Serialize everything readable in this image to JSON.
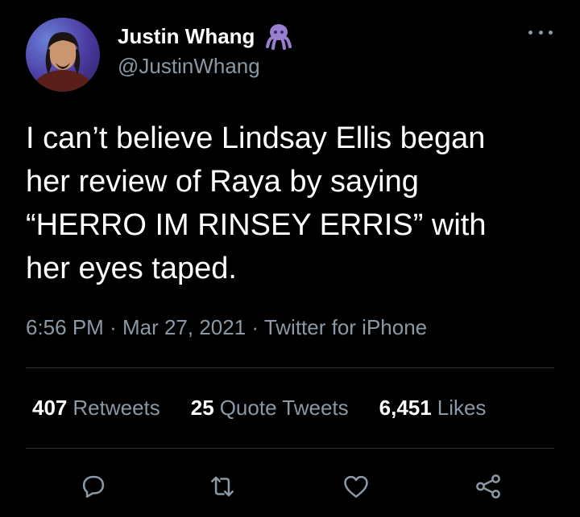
{
  "author": {
    "name": "Justin Whang",
    "handle": "@JustinWhang",
    "emoji_icon": "octopus-icon"
  },
  "tweet": {
    "text": "I can’t believe Lindsay Ellis began\nher review of Raya by saying\n“HERRO IM RINSEY ERRIS” with\nher eyes taped.",
    "time": "6:56 PM",
    "date": "Mar 27, 2021",
    "source": "Twitter for iPhone",
    "separator": "·"
  },
  "stats": {
    "retweets_count": "407",
    "retweets_label": "Retweets",
    "quotes_count": "25",
    "quotes_label": "Quote Tweets",
    "likes_count": "6,451",
    "likes_label": "Likes"
  },
  "actions": [
    "reply-icon",
    "retweet-icon",
    "like-icon",
    "share-icon"
  ],
  "colors": {
    "background": "#000000",
    "text_primary": "#ffffff",
    "text_secondary": "#8b98a5",
    "divider": "#2f3336",
    "emoji": "#9a7fd0"
  }
}
